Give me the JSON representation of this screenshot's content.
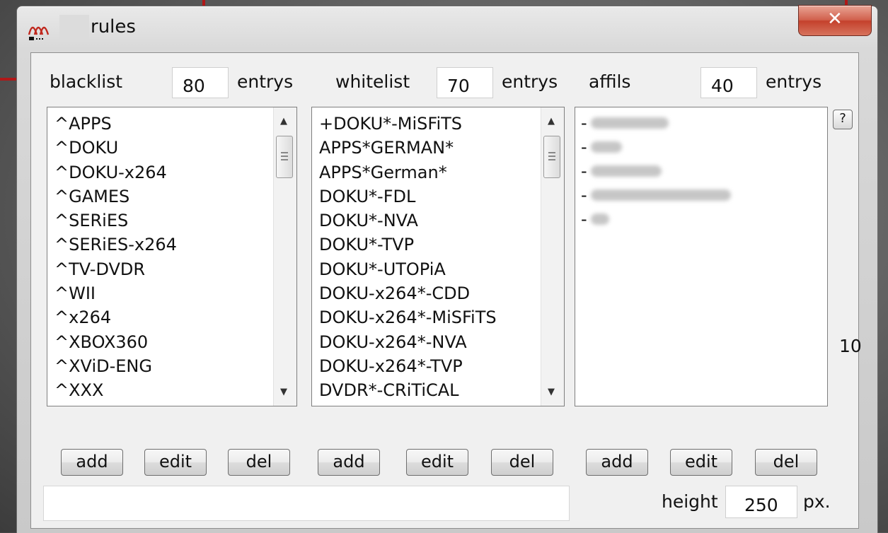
{
  "window": {
    "title": "rules",
    "close_label": "✕"
  },
  "blacklist": {
    "label": "blacklist",
    "count": "80",
    "count_unit": "entrys",
    "items": [
      "^APPS",
      "^DOKU",
      "^DOKU-x264",
      "^GAMES",
      "^SERiES",
      "^SERiES-x264",
      "^TV-DVDR",
      "^WII",
      "^x264",
      "^XBOX360",
      "^XViD-ENG",
      "^XXX"
    ]
  },
  "whitelist": {
    "label": "whitelist",
    "count": "70",
    "count_unit": "entrys",
    "items": [
      "+DOKU*-MiSFiTS",
      "APPS*GERMAN*",
      "APPS*German*",
      "DOKU*-FDL",
      "DOKU*-NVA",
      "DOKU*-TVP",
      "DOKU*-UTOPiA",
      "DOKU-x264*-CDD",
      "DOKU-x264*-MiSFiTS",
      "DOKU-x264*-NVA",
      "DOKU-x264*-TVP",
      "DVDR*-CRiTiCAL"
    ]
  },
  "affils": {
    "label": "affils",
    "count": "40",
    "count_unit": "entrys",
    "items": [
      "-",
      "-",
      "-",
      "-",
      "-"
    ]
  },
  "help_label": "?",
  "side_value": "10",
  "buttons": {
    "add": "add",
    "edit": "edit",
    "del": "del"
  },
  "status_text": "",
  "height": {
    "label": "height",
    "value": "250",
    "unit": "px."
  },
  "colors": {
    "annotation": "#b01818",
    "close_button": "#c4412c"
  }
}
